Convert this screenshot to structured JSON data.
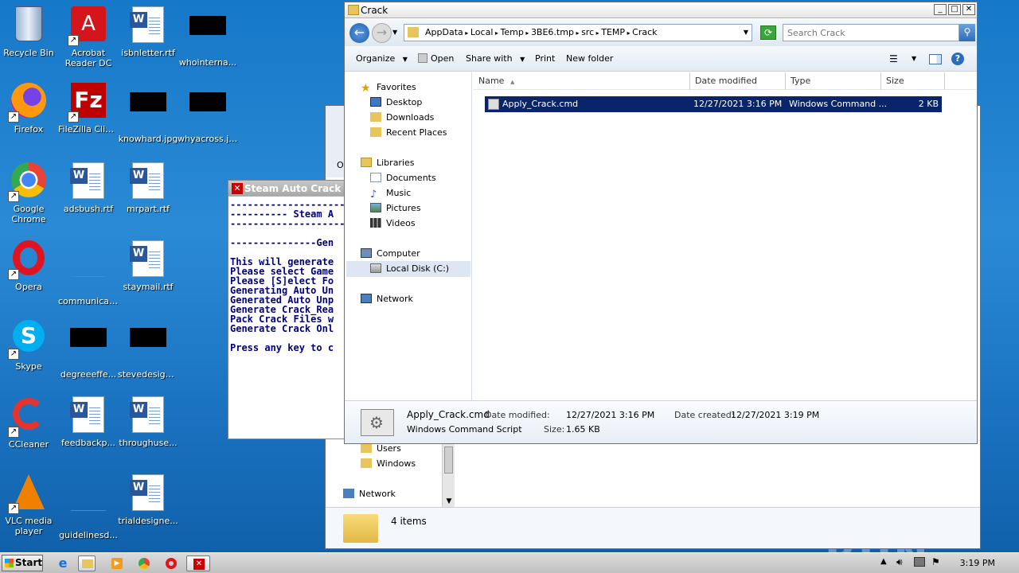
{
  "desktop": {
    "icons": [
      {
        "label": "Recycle Bin"
      },
      {
        "label": "Acrobat Reader DC"
      },
      {
        "label": "isbnletter.rtf"
      },
      {
        "label": "whointerna..."
      },
      {
        "label": "Firefox"
      },
      {
        "label": "FileZilla Client"
      },
      {
        "label": "knowhard.jpg"
      },
      {
        "label": "whyacross.jpg"
      },
      {
        "label": "Google Chrome"
      },
      {
        "label": "adsbush.rtf"
      },
      {
        "label": "mrpart.rtf"
      },
      {
        "label": "Opera"
      },
      {
        "label": "communicati..."
      },
      {
        "label": "staymail.rtf"
      },
      {
        "label": "Skype"
      },
      {
        "label": "degreeeffe..."
      },
      {
        "label": "stevedesign..."
      },
      {
        "label": "CCleaner"
      },
      {
        "label": "feedbackp..."
      },
      {
        "label": "throughuse..."
      },
      {
        "label": "VLC media player"
      },
      {
        "label": "guidelinesd..."
      },
      {
        "label": "trialdesigne..."
      }
    ],
    "watermark": "ANY RUN"
  },
  "cmd_window": {
    "title": "Steam Auto Crack V1",
    "lines": [
      "-----------------------",
      "---------- Steam A",
      "-----------------------",
      "",
      "---------------Gen",
      "",
      "This will generate",
      "Please select Game",
      "Please [S]elect Fo",
      "Generating Auto Un",
      "Generated Auto Unp",
      "Generate Crack_Rea",
      "Pack Crack Files w",
      "Generate Crack Onl",
      "",
      "Press any key to c"
    ]
  },
  "back_explorer": {
    "tree": [
      {
        "label": "Users"
      },
      {
        "label": "Windows"
      },
      {
        "label": "Network"
      }
    ],
    "status": "4 items",
    "partial_label": "O"
  },
  "explorer": {
    "title": "Crack",
    "breadcrumb": [
      "AppData",
      "Local",
      "Temp",
      "3BE6.tmp",
      "src",
      "TEMP",
      "Crack"
    ],
    "search_placeholder": "Search Crack",
    "toolbar": {
      "organize": "Organize",
      "open": "Open",
      "share_with": "Share with",
      "print": "Print",
      "new_folder": "New folder"
    },
    "nav": {
      "favorites": "Favorites",
      "desktop": "Desktop",
      "downloads": "Downloads",
      "recent": "Recent Places",
      "libraries": "Libraries",
      "documents": "Documents",
      "music": "Music",
      "pictures": "Pictures",
      "videos": "Videos",
      "computer": "Computer",
      "local_disk": "Local Disk (C:)",
      "network": "Network"
    },
    "columns": {
      "name": "Name",
      "date": "Date modified",
      "type": "Type",
      "size": "Size"
    },
    "files": [
      {
        "name": "Apply_Crack.cmd",
        "date": "12/27/2021 3:16 PM",
        "type": "Windows Command ...",
        "size": "2 KB"
      }
    ],
    "details": {
      "name": "Apply_Crack.cmd",
      "kind": "Windows Command Script",
      "date_modified_label": "Date modified:",
      "date_modified": "12/27/2021 3:16 PM",
      "date_created_label": "Date created:",
      "date_created": "12/27/2021 3:19 PM",
      "size_label": "Size:",
      "size": "1.65 KB"
    }
  },
  "taskbar": {
    "start": "Start",
    "clock": "3:19 PM"
  },
  "colors": {
    "selection": "#0a246a",
    "cmd_text": "#000080",
    "desktop": "#1b74c2"
  }
}
